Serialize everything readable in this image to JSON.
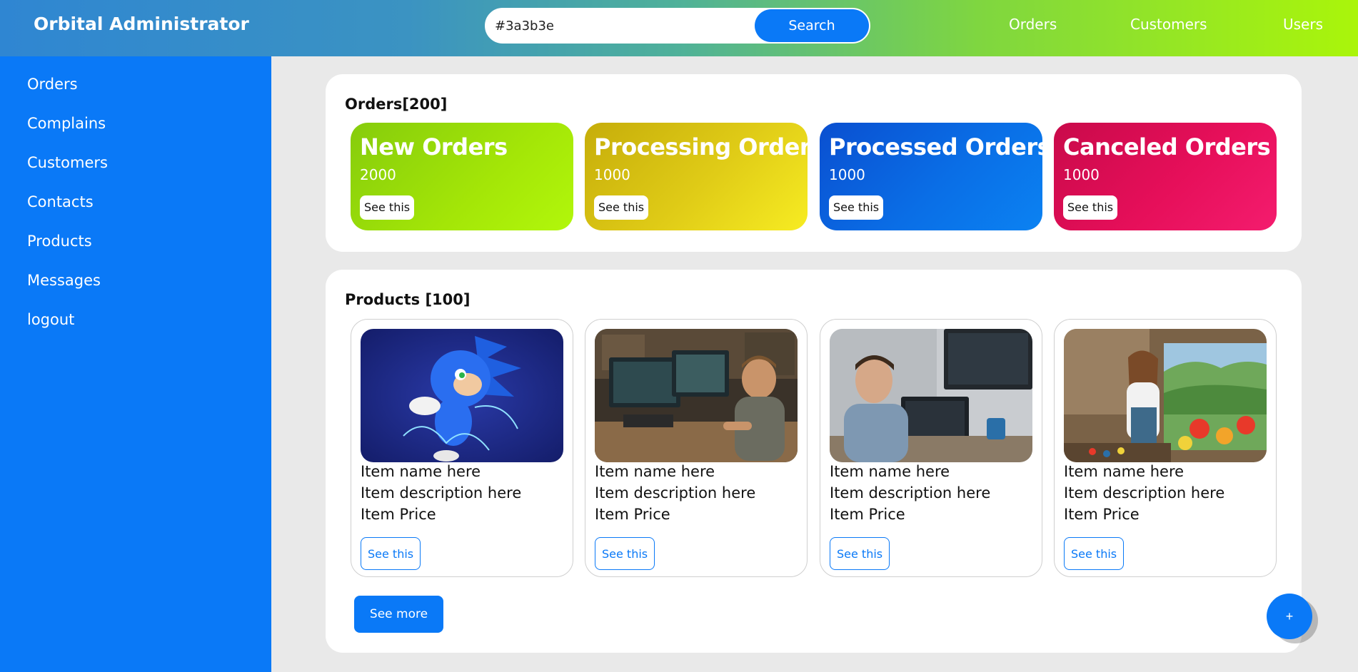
{
  "header": {
    "brand": "Orbital Administrator",
    "search_value": "#3a3b3e",
    "search_button": "Search",
    "nav": [
      "Orders",
      "Customers",
      "Users"
    ]
  },
  "sidebar": {
    "items": [
      "Orders",
      "Complains",
      "Customers",
      "Contacts",
      "Products",
      "Messages",
      "logout"
    ]
  },
  "orders": {
    "title": "Orders[200]",
    "cards": [
      {
        "title": "New Orders",
        "count": "2000",
        "button": "See this"
      },
      {
        "title": "Processing Orders",
        "count": "1000",
        "button": "See this"
      },
      {
        "title": "Processed Orders",
        "count": "1000",
        "button": "See this"
      },
      {
        "title": "Canceled Orders",
        "count": "1000",
        "button": "See this"
      }
    ]
  },
  "products": {
    "title": "Products [100]",
    "items": [
      {
        "name": "Item name here",
        "description": "Item description here",
        "price": "Item Price",
        "button": "See this"
      },
      {
        "name": "Item name here",
        "description": "Item description here",
        "price": "Item Price",
        "button": "See this"
      },
      {
        "name": "Item name here",
        "description": "Item description here",
        "price": "Item Price",
        "button": "See this"
      },
      {
        "name": "Item name here",
        "description": "Item description here",
        "price": "Item Price",
        "button": "See this"
      }
    ],
    "see_more": "See more"
  },
  "fab_label": "+",
  "colors": {
    "accent": "#0a79f7",
    "new_orders": "#90d50a",
    "processing_orders": "#e6d21c",
    "processed_orders": "#0a6ee6",
    "canceled_orders": "#e60f5a"
  }
}
